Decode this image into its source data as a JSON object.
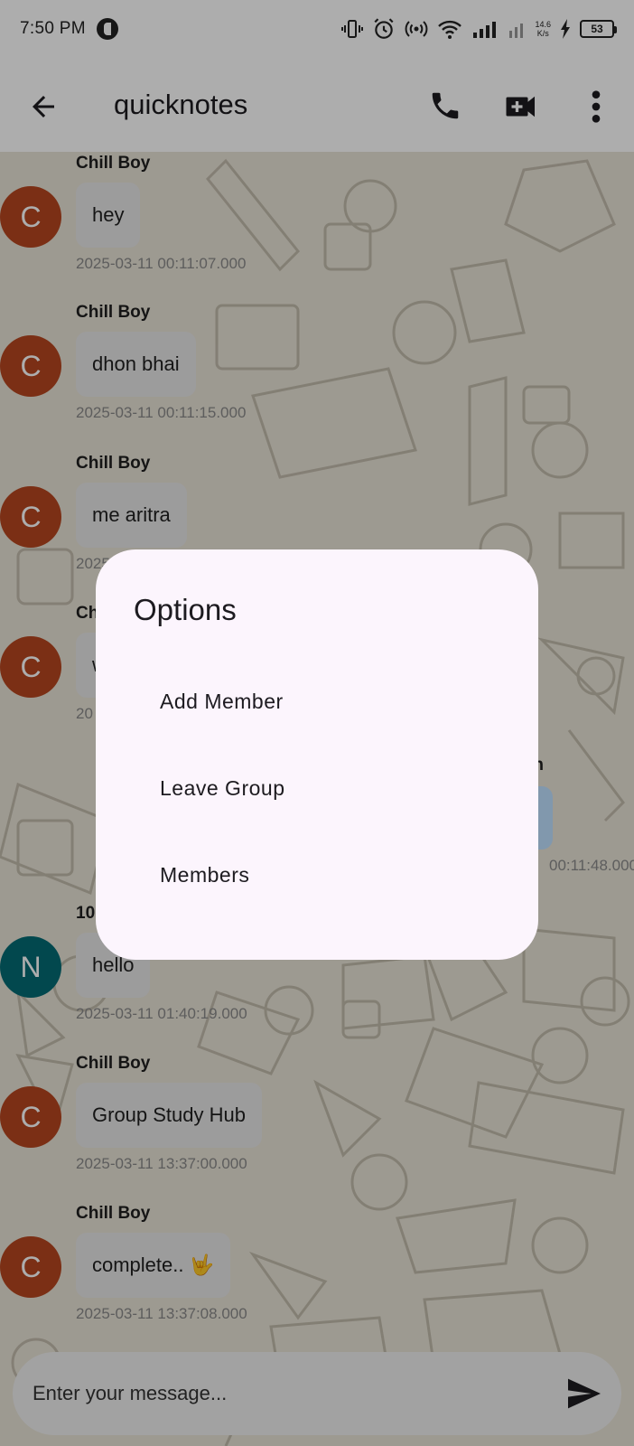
{
  "status_bar": {
    "time": "7:50 PM",
    "net_speed_top": "14.6",
    "net_speed_bottom": "K/s",
    "battery": "53"
  },
  "header": {
    "title": "quicknotes"
  },
  "messages": [
    {
      "sender": "Chill Boy",
      "initial": "C",
      "text": "hey",
      "time": "2025-03-11 00:11:07.000",
      "color": "#b5461f"
    },
    {
      "sender": "Chill Boy",
      "initial": "C",
      "text": "dhon bhai",
      "time": "2025-03-11 00:11:15.000",
      "color": "#b5461f"
    },
    {
      "sender": "Chill Boy",
      "initial": "C",
      "text": "me aritra",
      "time": "2025",
      "color": "#b5461f"
    },
    {
      "sender": "Ch",
      "initial": "C",
      "text": "w",
      "time": "20",
      "color": "#b5461f"
    },
    {
      "sender": "10",
      "initial": "N",
      "text": "hello",
      "time": "2025-03-11 01:40:19.000",
      "color": "#036a73"
    },
    {
      "sender": "Chill Boy",
      "initial": "C",
      "text": "Group Study Hub",
      "time": "2025-03-11 13:37:00.000",
      "color": "#b5461f"
    },
    {
      "sender": "Chill Boy",
      "initial": "C",
      "text": "complete.. 🤟",
      "time": "2025-03-11 13:37:08.000",
      "color": "#b5461f"
    }
  ],
  "right_message": {
    "sender": "th",
    "time": "00:11:48.000"
  },
  "composer": {
    "placeholder": "Enter your message..."
  },
  "dialog": {
    "title": "Options",
    "options": [
      "Add Member",
      "Leave Group",
      "Members"
    ]
  },
  "colors": {
    "accent_orange": "#b5461f",
    "accent_teal": "#036a73",
    "dialog_bg": "#fcf5fd",
    "scrim": "rgba(0,0,0,0.32)"
  },
  "icons": {
    "back": "arrow-left-icon",
    "call": "phone-icon",
    "video": "video-camera-icon",
    "more": "more-vertical-icon",
    "send": "send-icon"
  }
}
